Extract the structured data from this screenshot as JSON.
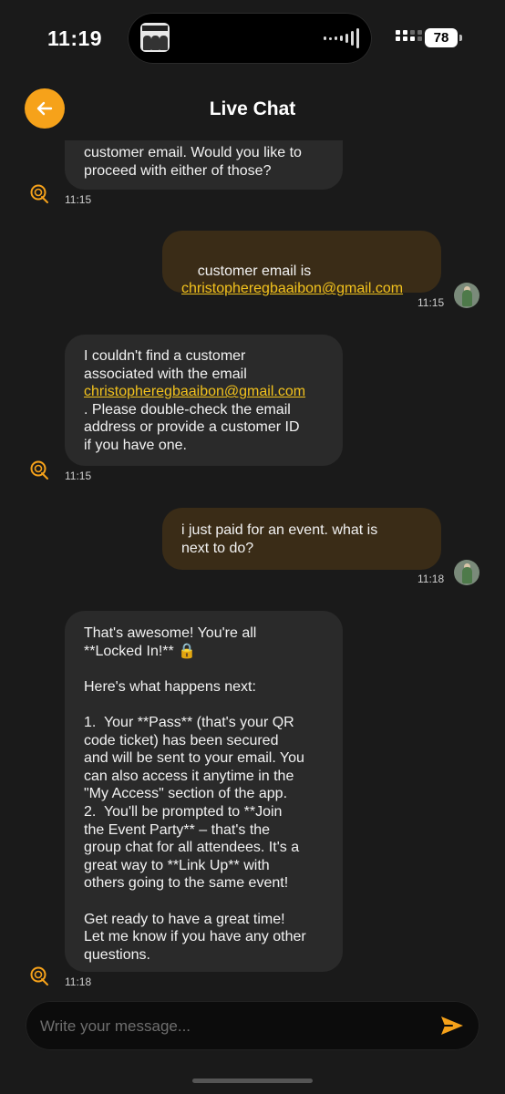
{
  "status": {
    "time": "11:19",
    "battery": "78"
  },
  "header": {
    "title": "Live Chat",
    "back_icon": "arrow-left-icon"
  },
  "messages": [
    {
      "sender": "bot",
      "text": "customer email. Would you like to\nproceed with either of those?",
      "time": "11:15"
    },
    {
      "sender": "user",
      "text": "customer email is",
      "email": "christopheregbaaibon@gmail.com",
      "time": "11:15"
    },
    {
      "sender": "bot",
      "text_before": "I couldn't find a customer\nassociated with the email",
      "email": "christopheregbaaibon@gmail.com",
      "text_after": ". Please double-check the email\naddress or provide a customer ID\nif you have one.",
      "time": "11:15"
    },
    {
      "sender": "user",
      "text": "i just paid for an event. what is\nnext to do?",
      "time": "11:18"
    },
    {
      "sender": "bot",
      "text": "That's awesome! You're all\n**Locked In!** 🔒\n\nHere's what happens next:\n\n1.  Your **Pass** (that's your QR\ncode ticket) has been secured\nand will be sent to your email. You\ncan also access it anytime in the\n\"My Access\" section of the app.\n2.  You'll be prompted to **Join\nthe Event Party** – that's the\ngroup chat for all attendees. It's a\ngreat way to **Link Up** with\nothers going to the same event!\n\nGet ready to have a great time!\nLet me know if you have any other\nquestions.",
      "time": "11:18"
    }
  ],
  "composer": {
    "placeholder": "Write your message...",
    "send_icon": "send-icon"
  },
  "colors": {
    "accent": "#f6a21a",
    "bot_bubble": "#2a2a2a",
    "user_bubble": "#3a2c17",
    "link": "#f2c21d"
  }
}
